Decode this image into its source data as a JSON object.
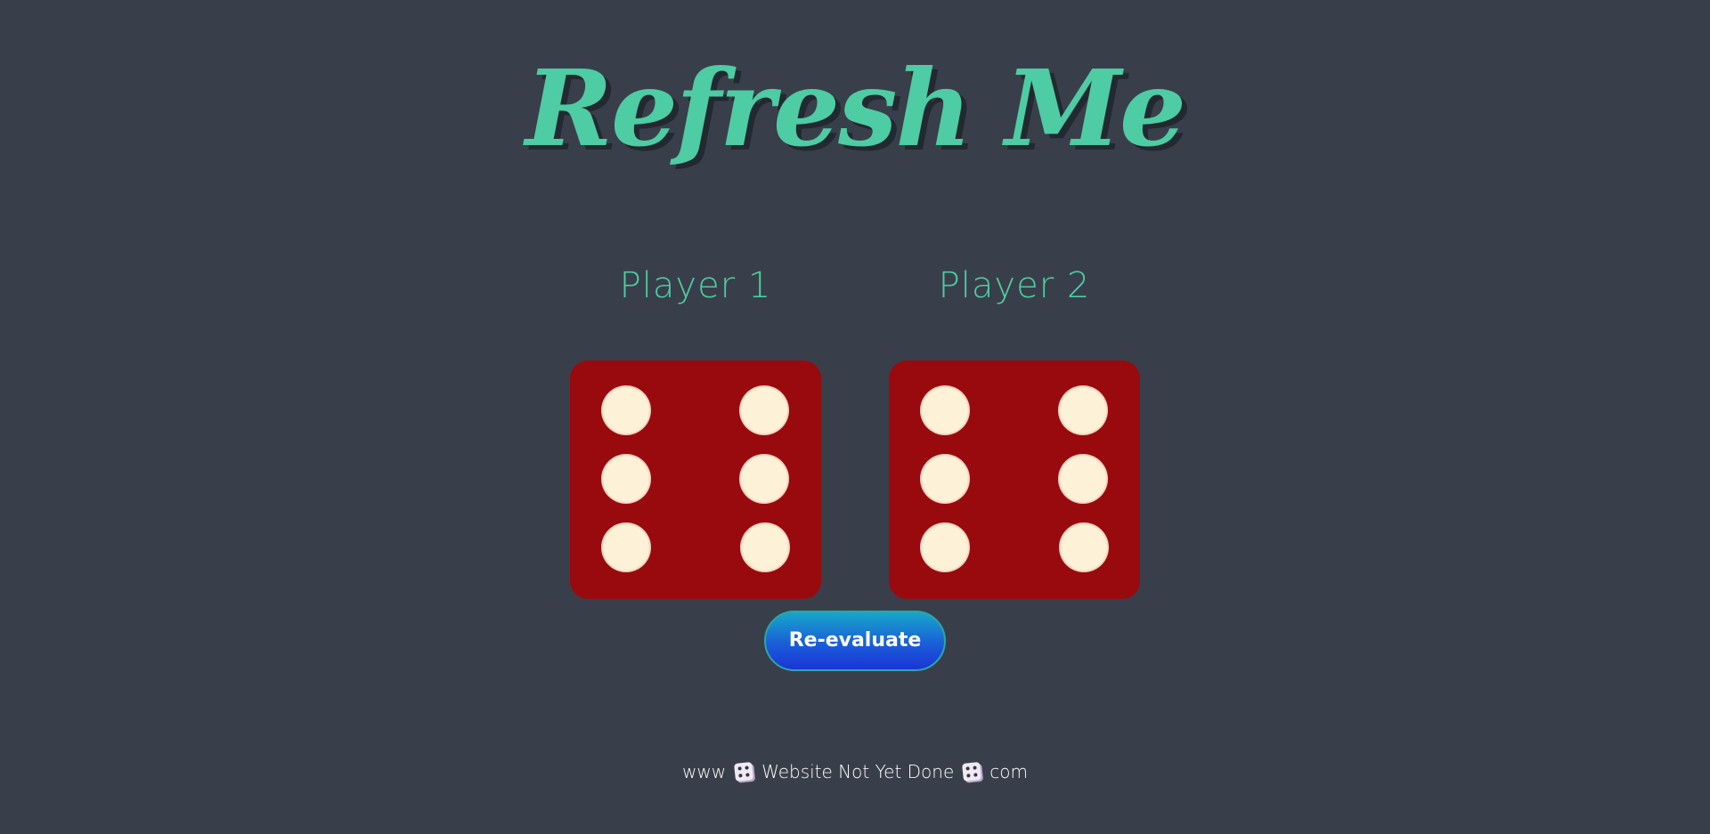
{
  "header": {
    "title": "Refresh Me"
  },
  "players": [
    {
      "label": "Player 1",
      "die_value": 6
    },
    {
      "label": "Player 2",
      "die_value": 6
    }
  ],
  "controls": {
    "reevaluate_label": "Re-evaluate"
  },
  "footer": {
    "prefix": "www",
    "middle": "Website Not Yet Done",
    "suffix": "com",
    "icon": "dice-icon"
  },
  "colors": {
    "background": "#393f4a",
    "accent": "#4ecca3",
    "die": "#990a0e",
    "pip": "#fdf1d8",
    "button_top": "#17a6c9",
    "button_bottom": "#1b34d6"
  }
}
